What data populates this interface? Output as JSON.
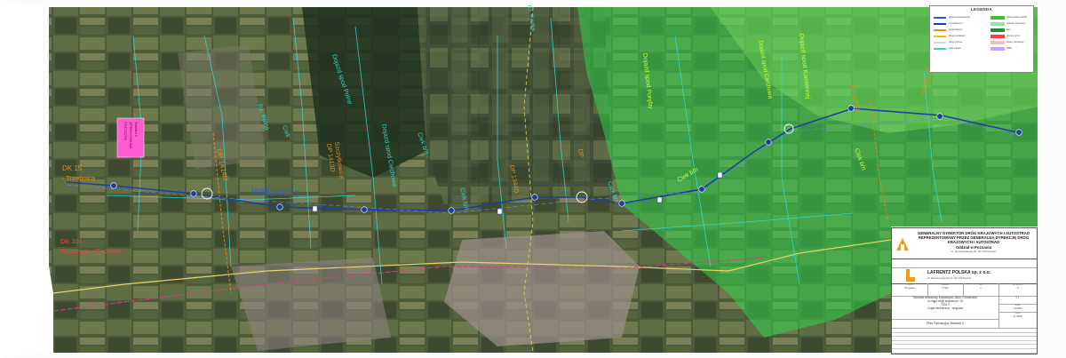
{
  "map_labels": {
    "dk15": "DK 15",
    "trzebnica": "- Trzebnica",
    "dk15_dopr_1": "DP 1414D",
    "dk15_dopr_2": "DP 1413D",
    "szczytkowice": "Szczytkowice",
    "wariant": "WARIANT 2",
    "dk_south": "DK 391",
    "dk_south_b": "Trzebnica - Chojnów",
    "pink_box": [
      "POCZĄTEK",
      "OPRACOWANIA",
      "Wariant 2"
    ],
    "rz_reflitka": "Rz. Rzutka",
    "ciek_a": "Ciek",
    "dojazd_spod_polne": "Dojazd spod Polne",
    "dojazd_spod_lesne": "Dojazd spod Ciechowa",
    "dojazd_spod_cieszk": "Dojazd spod Ciechowa",
    "ciek_bn": "Ciek b/n",
    "ciek_bn2": "Ciek b/n",
    "ciek_bn3": "Ciek b/n",
    "ciek_bn4": "Ciek b/n",
    "ciek_bn5": "Ciek b/n",
    "dojazd_spod_porycz": "Dojazd spod Poręby",
    "dojazd_spod_kamienna": "Dojazd spod Kamiennej",
    "dp_east_1": "DP 1355D",
    "dp_east_2": "DP 1345D",
    "dp_mid": "DP 1344D",
    "dp_mid2": "DP",
    "rz_west": "Rz. Polna"
  },
  "legend": {
    "title": "LEGENDA",
    "entries": [
      {
        "label": "granica opracowania",
        "color": "#2a5bd7"
      },
      {
        "label": "oś wariantu 2",
        "color": "#1c3fa3"
      },
      {
        "label": "drogi krajowe",
        "color": "#e88a1a"
      },
      {
        "label": "drogi powiatowe",
        "color": "#e8c21a"
      },
      {
        "label": "drogi gminne",
        "color": "#d8d8d8"
      },
      {
        "label": "cieki wodne",
        "color": "#2fd6c8"
      }
    ],
    "swatches": [
      {
        "label": "obszar Natura 2000",
        "color": "#3fbf3f"
      },
      {
        "label": "obszary chronione",
        "color": "#9fe09f"
      },
      {
        "label": "lasy",
        "color": "#1f8f2f"
      },
      {
        "label": "granice gmin",
        "color": "#ff3b3b"
      },
      {
        "label": "tereny zabudowy",
        "color": "#f0c0c0"
      },
      {
        "label": "PRW",
        "color": "#c8a0ff"
      }
    ]
  },
  "titleblock": {
    "client_lines": [
      "GENERALNY DYREKTOR DRÓG KRAJOWYCH I AUTOSTRAD",
      "REPREZENTOWANY PRZEZ GENERALNĄ DYREKCJĘ DRÓG",
      "KRAJOWYCH I AUTOSTRAD",
      "Oddział w Poznaniu"
    ],
    "client_address": "ul. Siemiradzkiego 5a, 60-763 Poznań",
    "client_logo_text": "GDDKiA",
    "designer": "LAFRENTZ POLSKA sp. z o.o.",
    "designer_address": "ul. Kamiennogórska 22, 60-179 Poznań",
    "meta": [
      {
        "head": "Branża",
        "value": "Drogowa"
      },
      {
        "head": "Stadium",
        "value": "STEŚ"
      },
      {
        "head": "Tom",
        "value": "2"
      },
      {
        "head": "Nr rysunku",
        "value": "2"
      }
    ],
    "description": [
      "Budowa obwodnicy Krotoszyna, Zduń i Cieszkowa",
      "w ciągu drogi krajowej nr 15",
      "TOM V",
      "Część techniczna - drogowa"
    ],
    "scale_head": "Skala",
    "scale": "1:10000",
    "date_head": "Data",
    "date": "01.2020",
    "sheet_no": "2.1",
    "sheet_title": "Plan Sytuacyjny Wariant 2"
  }
}
